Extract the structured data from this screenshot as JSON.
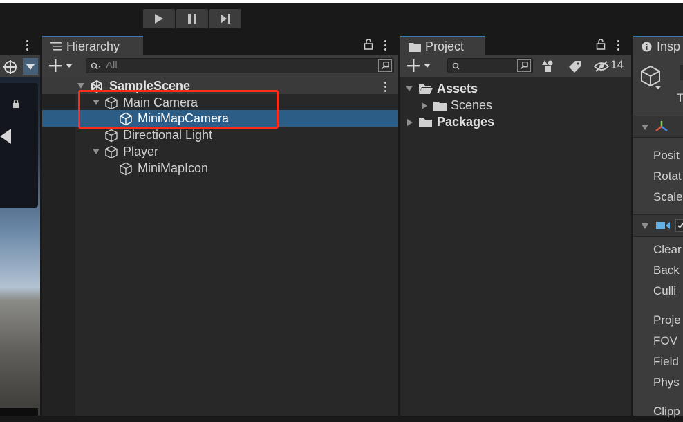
{
  "hierarchy": {
    "tab_label": "Hierarchy",
    "search_placeholder": "All",
    "items": [
      {
        "label": "SampleScene"
      },
      {
        "label": "Main Camera"
      },
      {
        "label": "MiniMapCamera"
      },
      {
        "label": "Directional Light"
      },
      {
        "label": "Player"
      },
      {
        "label": "MiniMapIcon"
      }
    ]
  },
  "project": {
    "tab_label": "Project",
    "hidden_count": "14",
    "items": [
      {
        "label": "Assets"
      },
      {
        "label": "Scenes"
      },
      {
        "label": "Packages"
      }
    ]
  },
  "inspector": {
    "tab_label": "Insp",
    "t_label": "T",
    "transform_rows": [
      "Posit",
      "Rotat",
      "Scale"
    ],
    "camera_rows": [
      "Clear",
      "Back",
      "Culli",
      "Proje",
      "FOV",
      "Field",
      "Phys",
      "Clipp"
    ]
  },
  "colors": {
    "selection": "#2c5d87",
    "highlight_box": "#ff2a1a",
    "tab_accent": "#3a79bb"
  }
}
